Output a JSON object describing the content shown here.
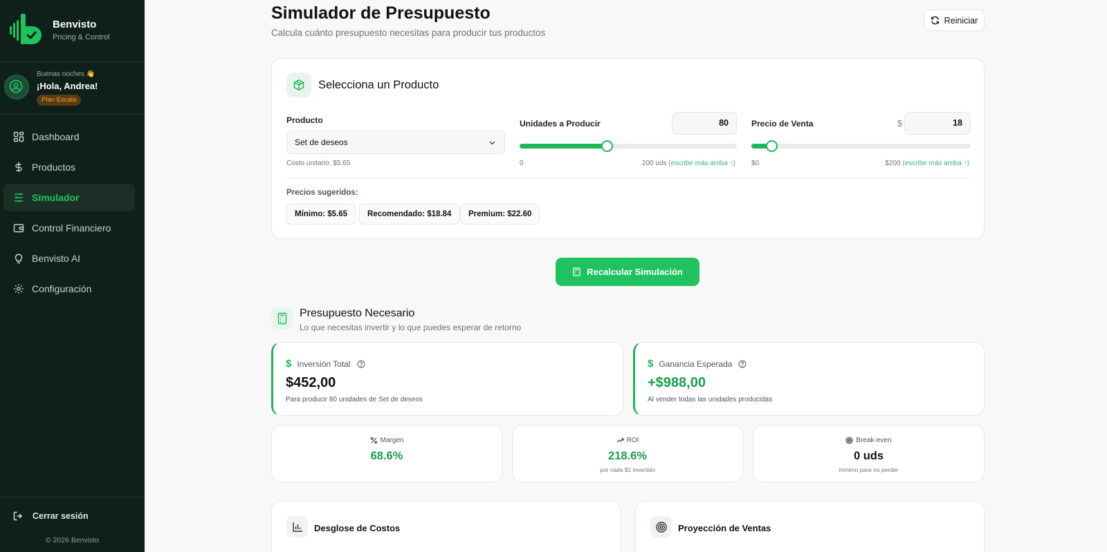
{
  "brand": {
    "name": "Benvisto",
    "subtitle": "Pricing & Control"
  },
  "user": {
    "greeting_small": "Buenas noches 👋",
    "greeting": "¡Hola, Andrea!",
    "plan": "Plan Escala"
  },
  "nav": {
    "items": [
      {
        "label": "Dashboard",
        "icon": "dashboard-icon"
      },
      {
        "label": "Productos",
        "icon": "dollar-icon"
      },
      {
        "label": "Simulador",
        "icon": "sliders-icon",
        "active": true
      },
      {
        "label": "Control Financiero",
        "icon": "wallet-icon"
      },
      {
        "label": "Benvisto AI",
        "icon": "lightbulb-icon"
      },
      {
        "label": "Configuración",
        "icon": "gear-icon"
      }
    ],
    "logout": "Cerrar sesión",
    "copyright": "© 2026 Benvisto"
  },
  "header": {
    "title": "Simulador de Presupuesto",
    "subtitle": "Calcula cuánto presupuesto necesitas para producir tus productos",
    "reset_label": "Reiniciar"
  },
  "product_card": {
    "title": "Selecciona un Producto",
    "product_label": "Producto",
    "product_value": "Set de deseos",
    "unit_cost": "Costo unitario: $5.65",
    "units_label": "Unidades a Producir",
    "units_value": "80",
    "units_min": "0",
    "units_max": "200 uds",
    "units_max_hint": "(escribe más arriba ↑)",
    "units_fraction": 0.4,
    "price_label": "Precio de Venta",
    "price_currency": "$",
    "price_value": "18",
    "price_min": "$0",
    "price_max": "$200",
    "price_max_hint": "(escribe más arriba ↑)",
    "price_fraction": 0.09,
    "suggested_label": "Precios sugeridos:",
    "suggested": [
      "Mínimo: $5.65",
      "Recomendado: $18.84",
      "Premium: $22.60"
    ]
  },
  "recalc_label": "Recalcular Simulación",
  "budget": {
    "title": "Presupuesto Necesario",
    "subtitle": "Lo que necesitas invertir y lo que puedes esperar de retorno",
    "investment": {
      "label": "Inversión Total",
      "value": "$452,00",
      "note": "Para producir 80 unidades de Set de deseos"
    },
    "profit": {
      "label": "Ganancia Esperada",
      "value": "+$988,00",
      "note": "Al vender todas las unidades producidas"
    },
    "currency_symbol": "$",
    "kpis": [
      {
        "label": "Margen",
        "value": "68.6%",
        "note": ""
      },
      {
        "label": "ROI",
        "value": "218.6%",
        "note": "por cada $1 invertido"
      },
      {
        "label": "Break-even",
        "value": "0 uds",
        "note": "mínimo para no perder"
      }
    ]
  },
  "bottom": {
    "costs_title": "Desglose de Costos",
    "sales_title": "Proyección de Ventas"
  },
  "colors": {
    "sidebar": "#0f1f19",
    "accent": "#1fc25f",
    "accent_dark": "#1b9e4b",
    "badge": "#5a3b12"
  }
}
